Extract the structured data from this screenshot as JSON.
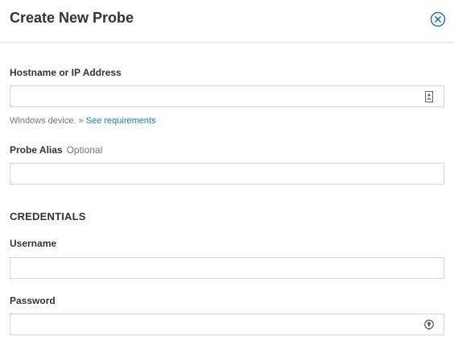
{
  "dialog": {
    "title": "Create New Probe",
    "close_icon": "close-circle-icon"
  },
  "hostname": {
    "label": "Hostname or IP Address",
    "value": "",
    "placeholder": "",
    "icon": "address-book-icon",
    "hint_text": "Windows device. » ",
    "hint_link": "See requirements"
  },
  "alias": {
    "label": "Probe Alias",
    "optional_text": "Optional",
    "value": "",
    "placeholder": ""
  },
  "credentials": {
    "heading": "CREDENTIALS",
    "username": {
      "label": "Username",
      "value": "",
      "placeholder": ""
    },
    "password": {
      "label": "Password",
      "value": "",
      "placeholder": "",
      "icon": "show-password-icon"
    }
  },
  "colors": {
    "link": "#1a7fb5",
    "close_icon": "#2b6ea6"
  }
}
